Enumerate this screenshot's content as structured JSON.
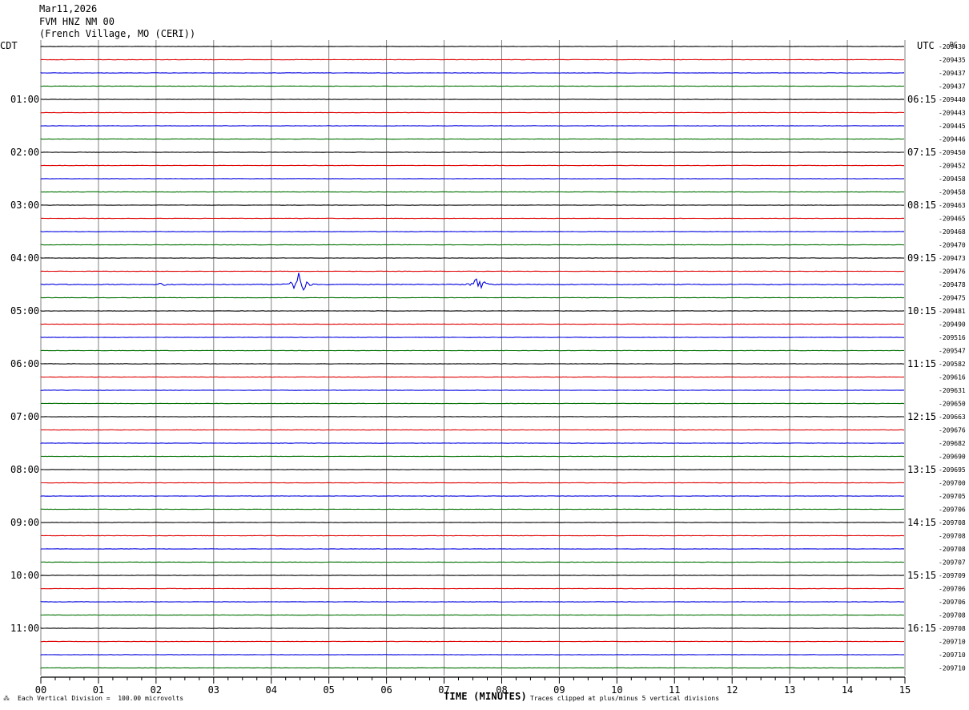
{
  "header": {
    "date": "Mar11,2026",
    "station": "FVM HNZ NM 00",
    "location": "(French Village, MO (CERI))"
  },
  "footer": {
    "symbol": "⁂",
    "scale_note": "Each Vertical Division =  100.00 microvolts",
    "clip_note": "Traces clipped at plus/minus 5 vertical divisions"
  },
  "colors": {
    "trace_cycle": [
      "#000000",
      "#e00000",
      "#0000e0",
      "#007000"
    ],
    "grid": "#808080"
  },
  "chart_data": {
    "type": "line",
    "title": "FVM HNZ NM 00",
    "xlabel": "TIME (MINUTES)",
    "xlim": [
      0,
      15
    ],
    "x_ticks": [
      "00",
      "01",
      "02",
      "03",
      "04",
      "05",
      "06",
      "07",
      "08",
      "09",
      "10",
      "11",
      "12",
      "13",
      "14",
      "15"
    ],
    "left_axis_label": "CDT",
    "right_axis_label": "UTC",
    "dc_label": "DC",
    "left_hour_labels": [
      "01:00",
      "02:00",
      "03:00",
      "04:00",
      "05:00",
      "06:00",
      "07:00",
      "08:00",
      "09:00",
      "10:00",
      "11:00"
    ],
    "right_hour_labels": [
      "06:15",
      "07:15",
      "08:15",
      "09:15",
      "10:15",
      "11:15",
      "12:15",
      "13:15",
      "14:15",
      "15:15",
      "16:15"
    ],
    "dc_offsets": [
      "-209430",
      "-209435",
      "-209437",
      "-209437",
      "-209440",
      "-209443",
      "-209445",
      "-209446",
      "-209450",
      "-209452",
      "-209458",
      "-209458",
      "-209463",
      "-209465",
      "-209468",
      "-209470",
      "-209473",
      "-209476",
      "-209478",
      "-209475",
      "-209481",
      "-209490",
      "-209516",
      "-209547",
      "-209582",
      "-209616",
      "-209631",
      "-209650",
      "-209663",
      "-209676",
      "-209682",
      "-209690",
      "-209695",
      "-209700",
      "-209705",
      "-209706",
      "-209708",
      "-209708",
      "-209708",
      "-209707",
      "-209709",
      "-209706",
      "-209706",
      "-209708",
      "-209708",
      "-209710",
      "-209710",
      "-209710"
    ],
    "events": [
      {
        "trace": 18,
        "minute": 4.48,
        "amplitude": 1.6
      },
      {
        "trace": 18,
        "minute": 7.6,
        "amplitude": 1.0
      },
      {
        "trace": 18,
        "minute": 2.1,
        "amplitude": 0.3
      }
    ]
  }
}
